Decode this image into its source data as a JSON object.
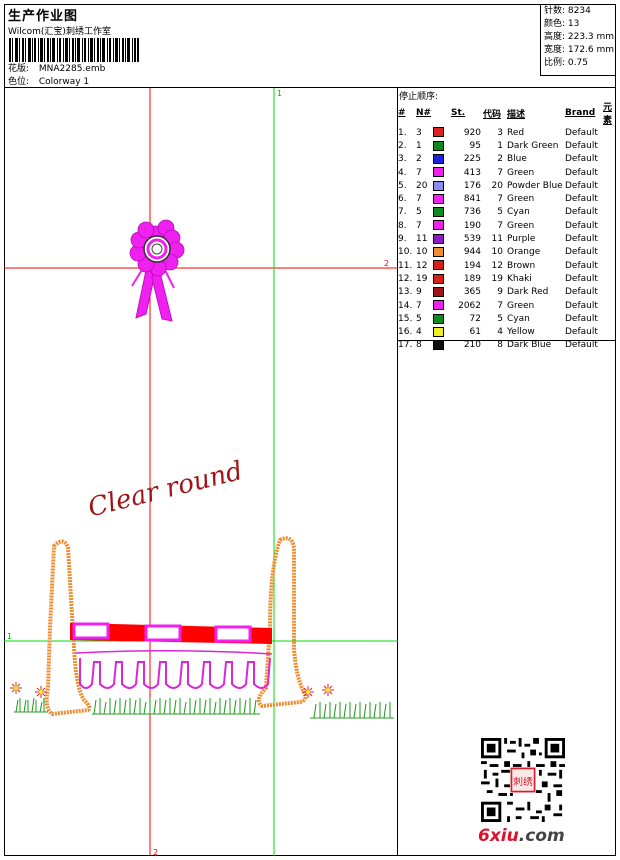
{
  "header": {
    "title": "生产作业图",
    "company": "Wilcom(汇宝)刺绣工作室",
    "design_label": "花版:",
    "design_value": "MNA2285.emb",
    "colorway_label": "色位:",
    "colorway_value": "Colorway 1"
  },
  "stats": {
    "stitches": "针数: 8234",
    "colors": "颜色: 13",
    "height": "高度: 223.3 mm",
    "width": "宽度: 172.6 mm",
    "scale": "比例: 0.75"
  },
  "canvas": {
    "marker_1_top": "1",
    "marker_1_left": "1",
    "marker_2_right": "2",
    "marker_2_bottom": "2",
    "lettering": "Clear round"
  },
  "stop_sequence": {
    "title": "停止顺序:",
    "headers": [
      "#",
      "N#",
      "St.",
      "代码",
      "描述",
      "Brand",
      "元素"
    ],
    "rows": [
      {
        "no": "1.",
        "n": "3",
        "color": "#e02020",
        "st": "920",
        "code": "3",
        "desc": "Red",
        "brand": "Default"
      },
      {
        "no": "2.",
        "n": "1",
        "color": "#0f8a1f",
        "st": "95",
        "code": "1",
        "desc": "Dark Green",
        "brand": "Default"
      },
      {
        "no": "3.",
        "n": "2",
        "color": "#1e20e0",
        "st": "225",
        "code": "2",
        "desc": "Blue",
        "brand": "Default"
      },
      {
        "no": "4.",
        "n": "7",
        "color": "#f020f0",
        "st": "413",
        "code": "7",
        "desc": "Green",
        "brand": "Default"
      },
      {
        "no": "5.",
        "n": "20",
        "color": "#8a8cf0",
        "st": "176",
        "code": "20",
        "desc": "Powder Blue",
        "brand": "Default"
      },
      {
        "no": "6.",
        "n": "7",
        "color": "#f020f0",
        "st": "841",
        "code": "7",
        "desc": "Green",
        "brand": "Default"
      },
      {
        "no": "7.",
        "n": "5",
        "color": "#0f8a1f",
        "st": "736",
        "code": "5",
        "desc": "Cyan",
        "brand": "Default"
      },
      {
        "no": "8.",
        "n": "7",
        "color": "#f020f0",
        "st": "190",
        "code": "7",
        "desc": "Green",
        "brand": "Default"
      },
      {
        "no": "9.",
        "n": "11",
        "color": "#9018c8",
        "st": "539",
        "code": "11",
        "desc": "Purple",
        "brand": "Default"
      },
      {
        "no": "10.",
        "n": "10",
        "color": "#f08c30",
        "st": "944",
        "code": "10",
        "desc": "Orange",
        "brand": "Default"
      },
      {
        "no": "11.",
        "n": "12",
        "color": "#d82018",
        "st": "194",
        "code": "12",
        "desc": "Brown",
        "brand": "Default"
      },
      {
        "no": "12.",
        "n": "19",
        "color": "#d82018",
        "st": "189",
        "code": "19",
        "desc": "Khaki",
        "brand": "Default"
      },
      {
        "no": "13.",
        "n": "9",
        "color": "#a01418",
        "st": "365",
        "code": "9",
        "desc": "Dark Red",
        "brand": "Default"
      },
      {
        "no": "14.",
        "n": "7",
        "color": "#f020f0",
        "st": "2062",
        "code": "7",
        "desc": "Green",
        "brand": "Default"
      },
      {
        "no": "15.",
        "n": "5",
        "color": "#0f8a1f",
        "st": "72",
        "code": "5",
        "desc": "Cyan",
        "brand": "Default"
      },
      {
        "no": "16.",
        "n": "4",
        "color": "#f0f020",
        "st": "61",
        "code": "4",
        "desc": "Yellow",
        "brand": "Default"
      },
      {
        "no": "17.",
        "n": "8",
        "color": "#101010",
        "st": "210",
        "code": "8",
        "desc": "Dark Blue",
        "brand": "Default"
      }
    ]
  },
  "watermark": {
    "qr_stamp": "刺绣",
    "site_name": "6xiu",
    "site_tld": ".com"
  }
}
